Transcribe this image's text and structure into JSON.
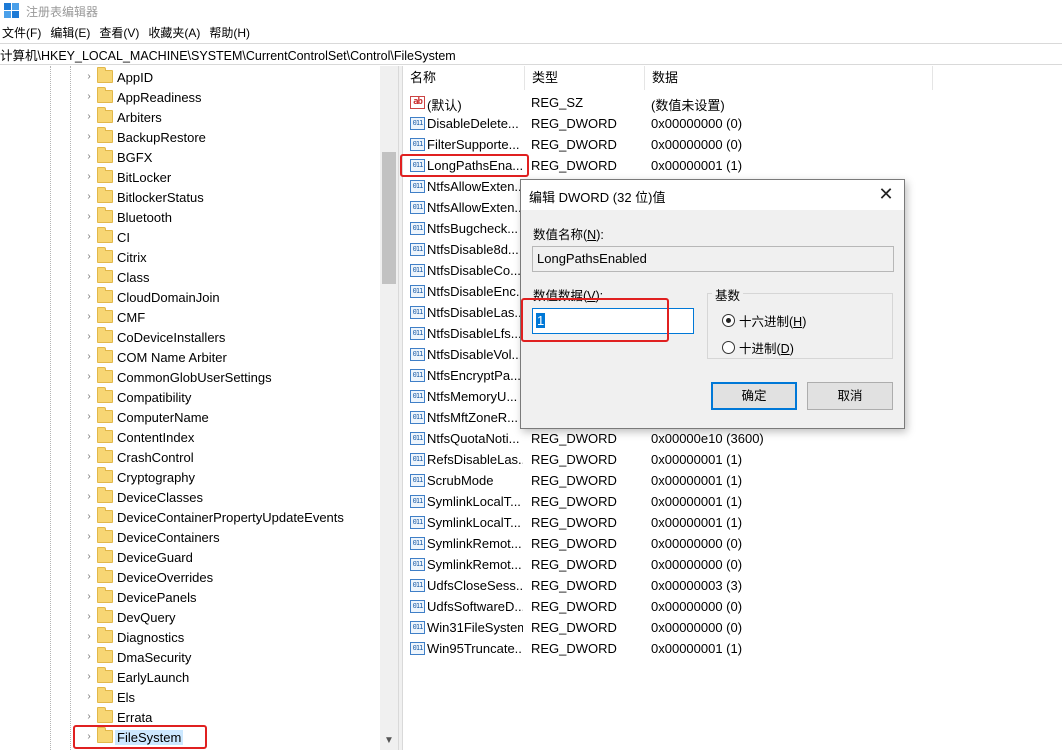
{
  "window": {
    "title": "注册表编辑器"
  },
  "menu": [
    "文件(F)",
    "编辑(E)",
    "查看(V)",
    "收藏夹(A)",
    "帮助(H)"
  ],
  "address": "计算机\\HKEY_LOCAL_MACHINE\\SYSTEM\\CurrentControlSet\\Control\\FileSystem",
  "tree": {
    "items": [
      "AppID",
      "AppReadiness",
      "Arbiters",
      "BackupRestore",
      "BGFX",
      "BitLocker",
      "BitlockerStatus",
      "Bluetooth",
      "CI",
      "Citrix",
      "Class",
      "CloudDomainJoin",
      "CMF",
      "CoDeviceInstallers",
      "COM Name Arbiter",
      "CommonGlobUserSettings",
      "Compatibility",
      "ComputerName",
      "ContentIndex",
      "CrashControl",
      "Cryptography",
      "DeviceClasses",
      "DeviceContainerPropertyUpdateEvents",
      "DeviceContainers",
      "DeviceGuard",
      "DeviceOverrides",
      "DevicePanels",
      "DevQuery",
      "Diagnostics",
      "DmaSecurity",
      "EarlyLaunch",
      "Els",
      "Errata",
      "FileSystem"
    ],
    "selected": "FileSystem"
  },
  "values": {
    "columns": {
      "name": "名称",
      "type": "类型",
      "data": "数据"
    },
    "rows": [
      {
        "name": "(默认)",
        "type": "REG_SZ",
        "data": "(数值未设置)",
        "icon": "string"
      },
      {
        "name": "DisableDelete...",
        "type": "REG_DWORD",
        "data": "0x00000000 (0)",
        "icon": "binary"
      },
      {
        "name": "FilterSupporte...",
        "type": "REG_DWORD",
        "data": "0x00000000 (0)",
        "icon": "binary"
      },
      {
        "name": "LongPathsEna...",
        "type": "REG_DWORD",
        "data": "0x00000001 (1)",
        "icon": "binary"
      },
      {
        "name": "NtfsAllowExten...",
        "type": "",
        "data": "",
        "icon": "binary"
      },
      {
        "name": "NtfsAllowExten...",
        "type": "",
        "data": "",
        "icon": "binary"
      },
      {
        "name": "NtfsBugcheck...",
        "type": "",
        "data": "",
        "icon": "binary"
      },
      {
        "name": "NtfsDisable8d...",
        "type": "",
        "data": "",
        "icon": "binary"
      },
      {
        "name": "NtfsDisableCo...",
        "type": "",
        "data": "",
        "icon": "binary"
      },
      {
        "name": "NtfsDisableEnc...",
        "type": "",
        "data": "",
        "icon": "binary"
      },
      {
        "name": "NtfsDisableLas...",
        "type": "",
        "data": "",
        "icon": "binary"
      },
      {
        "name": "NtfsDisableLfs...",
        "type": "",
        "data": "",
        "icon": "binary"
      },
      {
        "name": "NtfsDisableVol...",
        "type": "",
        "data": "",
        "icon": "binary"
      },
      {
        "name": "NtfsEncryptPa...",
        "type": "",
        "data": "",
        "icon": "binary"
      },
      {
        "name": "NtfsMemoryU...",
        "type": "",
        "data": "",
        "icon": "binary"
      },
      {
        "name": "NtfsMftZoneR...",
        "type": "",
        "data": "",
        "icon": "binary"
      },
      {
        "name": "NtfsQuotaNoti...",
        "type": "REG_DWORD",
        "data": "0x00000e10 (3600)",
        "icon": "binary"
      },
      {
        "name": "RefsDisableLas...",
        "type": "REG_DWORD",
        "data": "0x00000001 (1)",
        "icon": "binary"
      },
      {
        "name": "ScrubMode",
        "type": "REG_DWORD",
        "data": "0x00000001 (1)",
        "icon": "binary"
      },
      {
        "name": "SymlinkLocalT...",
        "type": "REG_DWORD",
        "data": "0x00000001 (1)",
        "icon": "binary"
      },
      {
        "name": "SymlinkLocalT...",
        "type": "REG_DWORD",
        "data": "0x00000001 (1)",
        "icon": "binary"
      },
      {
        "name": "SymlinkRemot...",
        "type": "REG_DWORD",
        "data": "0x00000000 (0)",
        "icon": "binary"
      },
      {
        "name": "SymlinkRemot...",
        "type": "REG_DWORD",
        "data": "0x00000000 (0)",
        "icon": "binary"
      },
      {
        "name": "UdfsCloseSess...",
        "type": "REG_DWORD",
        "data": "0x00000003 (3)",
        "icon": "binary"
      },
      {
        "name": "UdfsSoftwareD...",
        "type": "REG_DWORD",
        "data": "0x00000000 (0)",
        "icon": "binary"
      },
      {
        "name": "Win31FileSystem",
        "type": "REG_DWORD",
        "data": "0x00000000 (0)",
        "icon": "binary"
      },
      {
        "name": "Win95Truncate...",
        "type": "REG_DWORD",
        "data": "0x00000001 (1)",
        "icon": "binary"
      }
    ]
  },
  "dialog": {
    "title": "编辑 DWORD (32 位)值",
    "name_label": "数值名称(",
    "name_label_key": "N",
    "name_label_end": "):",
    "name_value": "LongPathsEnabled",
    "data_label": "数值数据(",
    "data_label_key": "V",
    "data_label_end": "):",
    "data_value": "1",
    "base_label": "基数",
    "radio_hex": "十六进制(",
    "radio_hex_key": "H",
    "radio_hex_end": ")",
    "radio_dec": "十进制(",
    "radio_dec_key": "D",
    "radio_dec_end": ")",
    "ok": "确定",
    "cancel": "取消"
  },
  "icons": {
    "binary_glyph": "011\n110",
    "string_glyph": "ab"
  }
}
